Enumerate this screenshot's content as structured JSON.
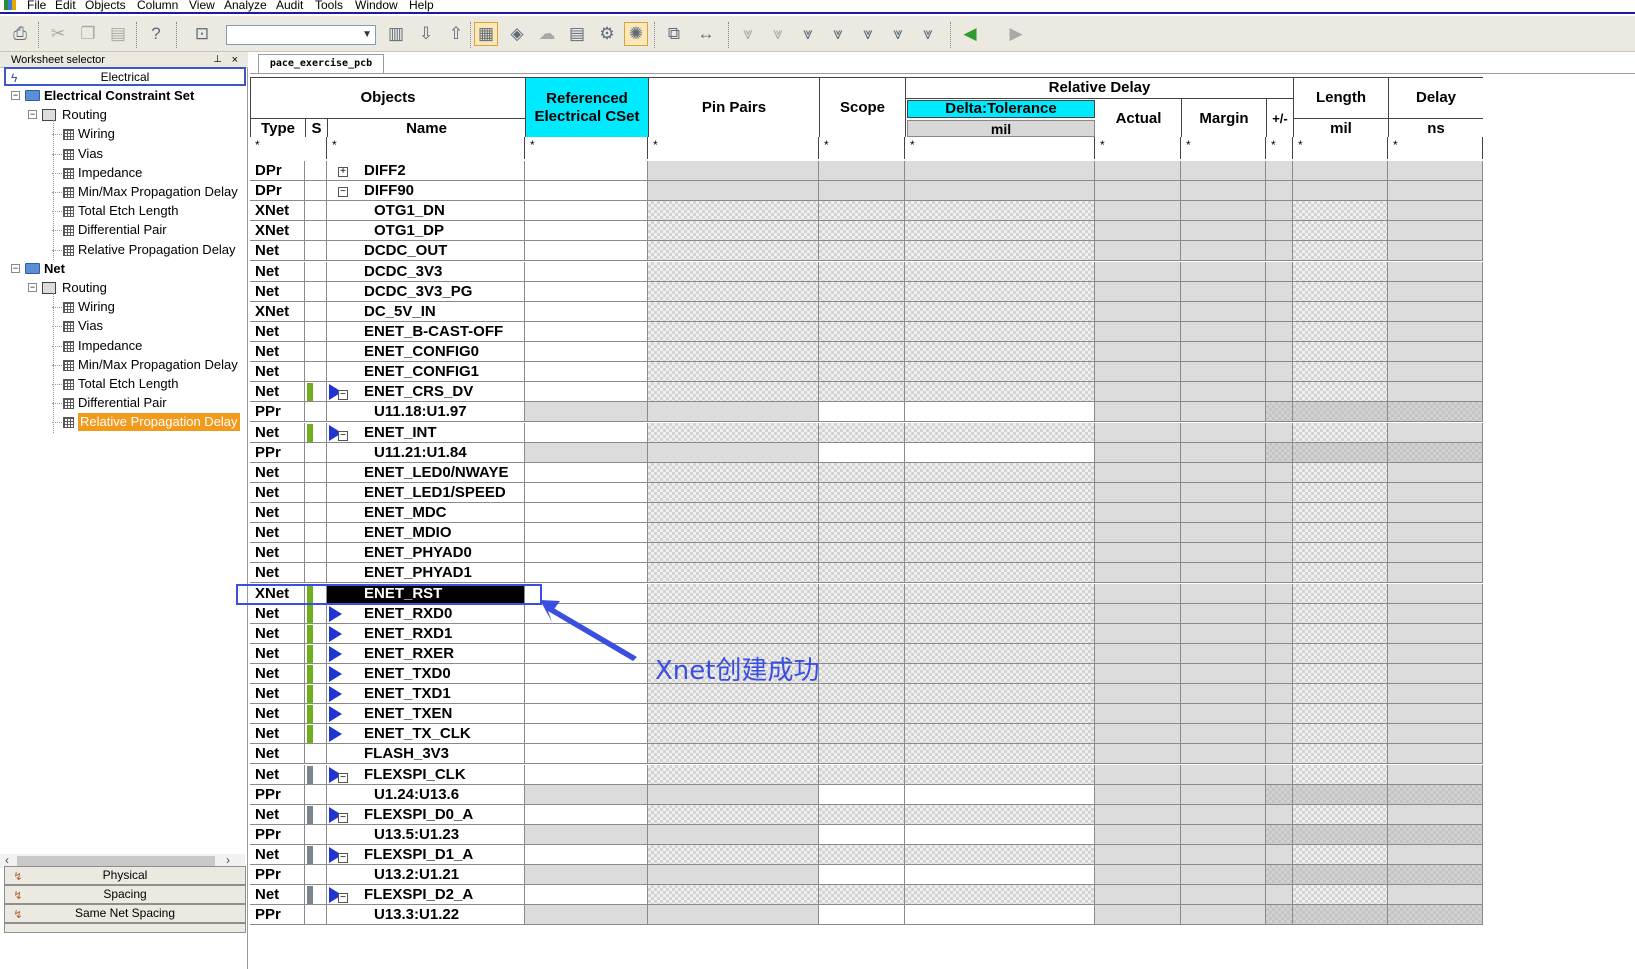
{
  "menu": [
    "File",
    "Edit",
    "Objects",
    "Column",
    "View",
    "Analyze",
    "Audit",
    "Tools",
    "Window",
    "Help"
  ],
  "toolbar": {
    "combo_value": ""
  },
  "left_panel": {
    "title": "Worksheet selector",
    "pin": "p",
    "close": "×",
    "top_tab": "Electrical",
    "tree": [
      {
        "label": "Electrical Constraint Set",
        "level": 0,
        "bold": true
      },
      {
        "label": "Routing",
        "level": 1
      },
      {
        "label": "Wiring",
        "level": 2
      },
      {
        "label": "Vias",
        "level": 2
      },
      {
        "label": "Impedance",
        "level": 2
      },
      {
        "label": "Min/Max Propagation Delay",
        "level": 2
      },
      {
        "label": "Total Etch Length",
        "level": 2
      },
      {
        "label": "Differential Pair",
        "level": 2
      },
      {
        "label": "Relative Propagation Delay",
        "level": 2
      },
      {
        "label": "Net",
        "level": 0,
        "bold": true
      },
      {
        "label": "Routing",
        "level": 1
      },
      {
        "label": "Wiring",
        "level": 2
      },
      {
        "label": "Vias",
        "level": 2
      },
      {
        "label": "Impedance",
        "level": 2
      },
      {
        "label": "Min/Max Propagation Delay",
        "level": 2
      },
      {
        "label": "Total Etch Length",
        "level": 2
      },
      {
        "label": "Differential Pair",
        "level": 2
      },
      {
        "label": "Relative Propagation Delay",
        "level": 2,
        "selected": true
      }
    ],
    "bottom_tabs": [
      "Physical",
      "Spacing",
      "Same Net Spacing"
    ]
  },
  "worksheet_tab": "pace_exercise_pcb",
  "grid": {
    "headers": {
      "objects": "Objects",
      "type": "Type",
      "s": "S",
      "name": "Name",
      "ref_cset": "Referenced Electrical CSet",
      "pin_pairs": "Pin Pairs",
      "scope": "Scope",
      "relative_delay": "Relative Delay",
      "delta_tol": "Delta:Tolerance",
      "delta_unit": "mil",
      "actual": "Actual",
      "margin": "Margin",
      "pm": "+/-",
      "length": "Length",
      "length_unit": "mil",
      "delay": "Delay",
      "delay_unit": "ns"
    },
    "filter": "*",
    "rows": [
      {
        "type": "DPr",
        "name": "DIFF2",
        "marker": "plus"
      },
      {
        "type": "DPr",
        "name": "DIFF90",
        "marker": "minus"
      },
      {
        "type": "XNet",
        "name": "OTG1_DN",
        "child": true
      },
      {
        "type": "XNet",
        "name": "OTG1_DP",
        "child": true
      },
      {
        "type": "Net",
        "name": "DCDC_OUT"
      },
      {
        "type": "Net",
        "name": "DCDC_3V3"
      },
      {
        "type": "Net",
        "name": "DCDC_3V3_PG"
      },
      {
        "type": "XNet",
        "name": "DC_5V_IN"
      },
      {
        "type": "Net",
        "name": "ENET_B-CAST-OFF"
      },
      {
        "type": "Net",
        "name": "ENET_CONFIG0"
      },
      {
        "type": "Net",
        "name": "ENET_CONFIG1"
      },
      {
        "type": "Net",
        "name": "ENET_CRS_DV",
        "sbar": "green",
        "marker": "tri-minus"
      },
      {
        "type": "PPr",
        "name": "U11.18:U1.97",
        "child": true,
        "ppr": true
      },
      {
        "type": "Net",
        "name": "ENET_INT",
        "sbar": "green",
        "marker": "tri-minus"
      },
      {
        "type": "PPr",
        "name": "U11.21:U1.84",
        "child": true,
        "ppr": true
      },
      {
        "type": "Net",
        "name": "ENET_LED0/NWAYE"
      },
      {
        "type": "Net",
        "name": "ENET_LED1/SPEED"
      },
      {
        "type": "Net",
        "name": "ENET_MDC"
      },
      {
        "type": "Net",
        "name": "ENET_MDIO"
      },
      {
        "type": "Net",
        "name": "ENET_PHYAD0"
      },
      {
        "type": "Net",
        "name": "ENET_PHYAD1"
      },
      {
        "type": "XNet",
        "name": "ENET_RST",
        "sbar": "green",
        "selected": true
      },
      {
        "type": "Net",
        "name": "ENET_RXD0",
        "sbar": "green",
        "marker": "tri"
      },
      {
        "type": "Net",
        "name": "ENET_RXD1",
        "sbar": "green",
        "marker": "tri"
      },
      {
        "type": "Net",
        "name": "ENET_RXER",
        "sbar": "green",
        "marker": "tri"
      },
      {
        "type": "Net",
        "name": "ENET_TXD0",
        "sbar": "green",
        "marker": "tri"
      },
      {
        "type": "Net",
        "name": "ENET_TXD1",
        "sbar": "green",
        "marker": "tri"
      },
      {
        "type": "Net",
        "name": "ENET_TXEN",
        "sbar": "green",
        "marker": "tri"
      },
      {
        "type": "Net",
        "name": "ENET_TX_CLK",
        "sbar": "green",
        "marker": "tri"
      },
      {
        "type": "Net",
        "name": "FLASH_3V3"
      },
      {
        "type": "Net",
        "name": "FLEXSPI_CLK",
        "sbar": "gray",
        "marker": "tri-minus"
      },
      {
        "type": "PPr",
        "name": "U1.24:U13.6",
        "child": true,
        "ppr": true
      },
      {
        "type": "Net",
        "name": "FLEXSPI_D0_A",
        "sbar": "gray",
        "marker": "tri-minus"
      },
      {
        "type": "PPr",
        "name": "U13.5:U1.23",
        "child": true,
        "ppr": true
      },
      {
        "type": "Net",
        "name": "FLEXSPI_D1_A",
        "sbar": "gray",
        "marker": "tri-minus"
      },
      {
        "type": "PPr",
        "name": "U13.2:U1.21",
        "child": true,
        "ppr": true
      },
      {
        "type": "Net",
        "name": "FLEXSPI_D2_A",
        "sbar": "gray",
        "marker": "tri-minus"
      },
      {
        "type": "PPr",
        "name": "U13.3:U1.22",
        "child": true,
        "ppr": true
      }
    ]
  },
  "annotation": {
    "text": "Xnet创建成功"
  },
  "colors": {
    "accent_cyan": "#00eaff",
    "selection_orange": "#f29a1c",
    "annotation_blue": "#3a4fe0",
    "s_green": "#6fae1e"
  }
}
